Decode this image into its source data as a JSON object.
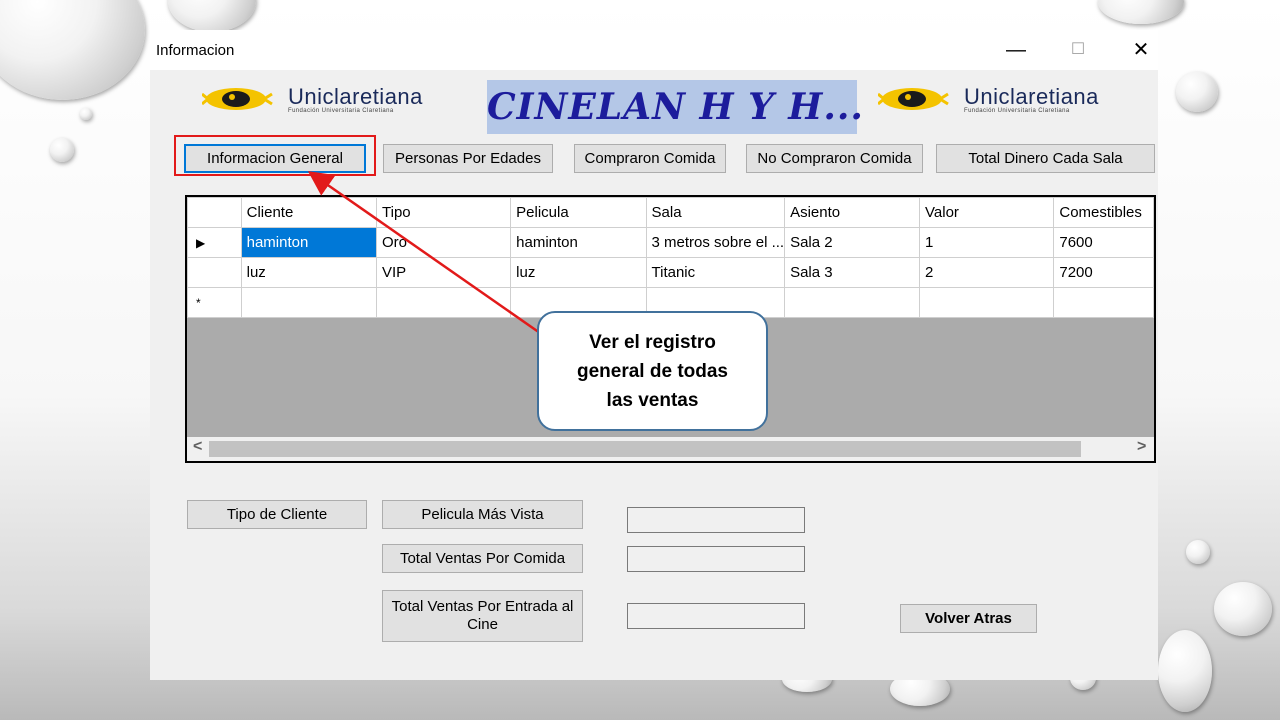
{
  "window": {
    "title": "Informacion",
    "minimize_glyph": "—",
    "maximize_glyph": "☐",
    "close_glyph": "✕"
  },
  "header": {
    "logo_brand": "Uniclaretiana",
    "logo_sub": "Fundación Universitaria Claretiana",
    "cinema_title": "CINELAN H Y H...",
    "title_bg_color": "#b4c7e7"
  },
  "top_buttons": [
    {
      "label": "Informacion General",
      "active": true
    },
    {
      "label": "Personas Por Edades",
      "active": false
    },
    {
      "label": "Compraron Comida",
      "active": false
    },
    {
      "label": "No Compraron Comida",
      "active": false
    },
    {
      "label": "Total Dinero Cada Sala",
      "active": false
    }
  ],
  "grid": {
    "columns": [
      "Cliente",
      "Tipo",
      "Pelicula",
      "Sala",
      "Asiento",
      "Valor",
      "Comestibles"
    ],
    "rows": [
      {
        "marker": "▶",
        "cells": [
          "haminton",
          "Oro",
          "haminton",
          "3 metros sobre el ...",
          "Sala 2",
          "1",
          "7600"
        ]
      },
      {
        "marker": "",
        "cells": [
          "luz",
          "VIP",
          "luz",
          "Titanic",
          "Sala 3",
          "2",
          "7200"
        ]
      }
    ],
    "new_row_marker": "*",
    "scroll_left": "<",
    "scroll_right": ">"
  },
  "bottom_buttons": {
    "tipo_cliente": "Tipo de Cliente",
    "pelicula_mas_vista": "Pelicula Más Vista",
    "total_ventas_comida": "Total Ventas Por Comida",
    "total_ventas_entrada": "Total Ventas Por Entrada al Cine",
    "volver_atras": "Volver Atras"
  },
  "callout": {
    "line1": "Ver el registro",
    "line2": "general de todas",
    "line3": "las ventas"
  },
  "colors": {
    "highlight_red": "#e21a1a",
    "selection_blue": "#0078d7",
    "callout_border": "#41719c"
  }
}
